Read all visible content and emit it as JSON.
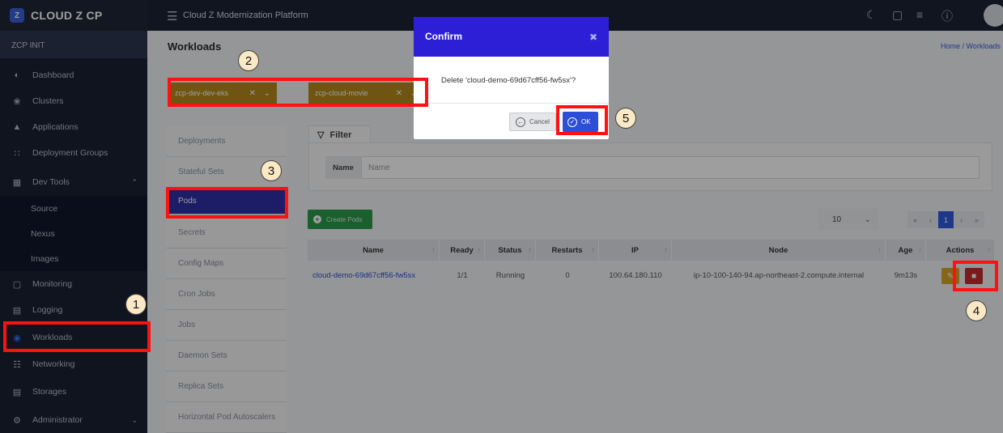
{
  "app": {
    "brand": "CLOUD Z CP",
    "brand_logo": "Z",
    "platform_title": "Cloud Z Modernization Platform"
  },
  "topbar_icons": [
    "moon-icon",
    "monitor-icon",
    "list-icon",
    "help-icon",
    "avatar"
  ],
  "sidebar": {
    "section": "ZCP INIT",
    "items": [
      {
        "label": "Dashboard",
        "icon": "dashboard-icon"
      },
      {
        "label": "Clusters",
        "icon": "cluster-icon"
      },
      {
        "label": "Applications",
        "icon": "applications-icon"
      },
      {
        "label": "Deployment Groups",
        "icon": "grid-icon"
      },
      {
        "label": "Dev Tools",
        "icon": "devtools-icon",
        "expanded": true
      },
      {
        "label": "Monitoring",
        "icon": "monitor-icon"
      },
      {
        "label": "Logging",
        "icon": "logging-icon"
      },
      {
        "label": "Workloads",
        "icon": "globe-icon",
        "active": true
      },
      {
        "label": "Networking",
        "icon": "network-icon"
      },
      {
        "label": "Storages",
        "icon": "storage-icon"
      },
      {
        "label": "Administrator",
        "icon": "gear-icon"
      }
    ],
    "dev_tools_sub": [
      "Source",
      "Nexus",
      "Images"
    ]
  },
  "page": {
    "title": "Workloads",
    "breadcrumb": "Home / Workloads"
  },
  "selectors": [
    {
      "value": "zcp-dev-dev-eks"
    },
    {
      "value": "zcp-cloud-movie"
    }
  ],
  "resources": [
    "Deployments",
    "Stateful Sets",
    "Pods",
    "Secrets",
    "Config Maps",
    "Cron Jobs",
    "Jobs",
    "Daemon Sets",
    "Replica Sets",
    "Horizontal Pod Autoscalers"
  ],
  "active_resource": "Pods",
  "filter": {
    "title": "Filter",
    "name_label": "Name",
    "name_placeholder": "Name"
  },
  "toolbar": {
    "create_label": "Create Pods",
    "per_page": "10",
    "current_page": "1"
  },
  "table": {
    "columns": [
      "Name",
      "Ready",
      "Status",
      "Restarts",
      "IP",
      "Node",
      "Age",
      "Actions"
    ],
    "rows": [
      {
        "name": "cloud-demo-69d67cff56-fw5sx",
        "ready": "1/1",
        "status": "Running",
        "restarts": "0",
        "ip": "100.64.180.110",
        "node": "ip-10-100-140-94.ap-northeast-2.compute.internal",
        "age": "9m13s"
      }
    ]
  },
  "modal": {
    "title": "Confirm",
    "message": "Delete 'cloud-demo-69d67cff56-fw5sx'?",
    "cancel_label": "Cancel",
    "ok_label": "OK"
  },
  "steps": [
    "1",
    "2",
    "3",
    "4",
    "5"
  ],
  "colors": {
    "highlight": "#ff1111",
    "modal_header": "#2d1fd6",
    "active_resource": "#2f2ea5",
    "selector": "#b48a1e",
    "create_button": "#2b9a4b",
    "delete_button": "#c62a2a"
  }
}
